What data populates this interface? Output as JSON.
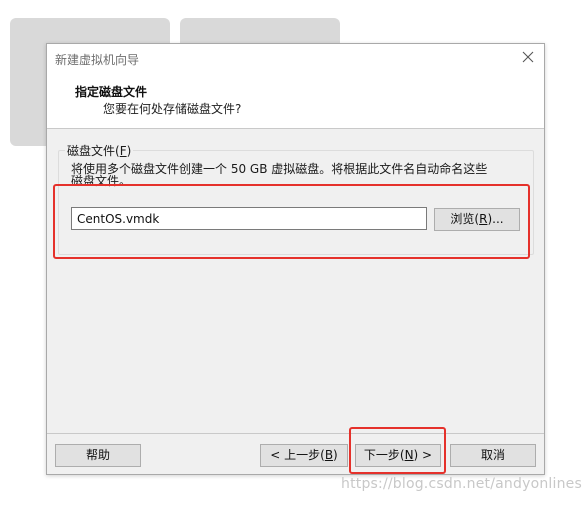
{
  "window": {
    "title": "新建虚拟机向导",
    "close_icon": "close-icon"
  },
  "header": {
    "title": "指定磁盘文件",
    "subtitle": "您要在何处存储磁盘文件?"
  },
  "disk_file_group": {
    "label_text": "磁盘文件(",
    "label_accel": "F",
    "label_end": ")",
    "description": "将使用多个磁盘文件创建一个 50 GB 虚拟磁盘。将根据此文件名自动命名这些磁盘文件。",
    "file_value": "CentOS.vmdk",
    "browse_text": "浏览(",
    "browse_accel": "R",
    "browse_end": ")..."
  },
  "footer": {
    "help_label": "帮助",
    "back_text": "< 上一步(",
    "back_accel": "B",
    "back_end": ")",
    "next_text": "下一步(",
    "next_accel": "N",
    "next_end": ") >",
    "cancel_label": "取消"
  },
  "annotation_color": "#e5312b",
  "watermark": "https://blog.csdn.net/andyonlines"
}
